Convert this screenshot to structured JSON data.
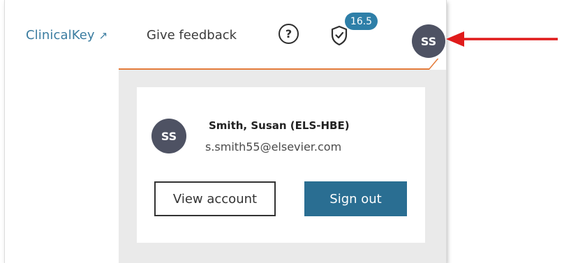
{
  "header": {
    "clinicalkey_label": "ClinicalKey",
    "external_link_glyph": "↗",
    "feedback_label": "Give feedback",
    "help_glyph": "?",
    "badge_value": "16.5",
    "avatar_initials": "SS"
  },
  "account_menu": {
    "avatar_initials": "SS",
    "user_name": "Smith, Susan (ELS-HBE)",
    "user_email": "s.smith55@elsevier.com",
    "view_account_label": "View account",
    "sign_out_label": "Sign out"
  },
  "colors": {
    "link": "#3a7ca0",
    "accent": "#e47b3a",
    "primary_button": "#2a6e92",
    "badge": "#2e7fa8",
    "avatar": "#4e5263",
    "annotation_arrow": "#e01b1b"
  }
}
